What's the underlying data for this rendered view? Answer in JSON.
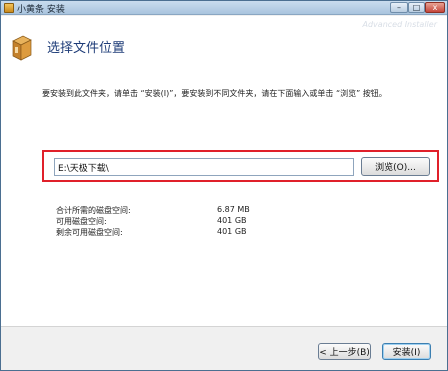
{
  "window": {
    "title": "小黄条 安装",
    "controls": {
      "minimize": "–",
      "maximize": "□",
      "close": "x"
    },
    "watermark": "Advanced Installer"
  },
  "header": {
    "title": "选择文件位置",
    "icon": "box-package-icon"
  },
  "main": {
    "instruction": "要安装到此文件夹，请单击 “安装(I)”，要安装到不同文件夹，请在下面输入或单击 “浏览” 按钮。",
    "path_value": "E:\\天极下载\\",
    "browse_label": "浏览(O)...",
    "highlight_color": "#e0202a"
  },
  "disk": {
    "rows": [
      {
        "label": "合计所需的磁盘空间:",
        "value": "6.87 MB"
      },
      {
        "label": "可用磁盘空间:",
        "value": "401 GB"
      },
      {
        "label": "剩余可用磁盘空间:",
        "value": "401 GB"
      }
    ]
  },
  "footer": {
    "back_label": "< 上一步(B)",
    "install_label": "安装(I)"
  }
}
